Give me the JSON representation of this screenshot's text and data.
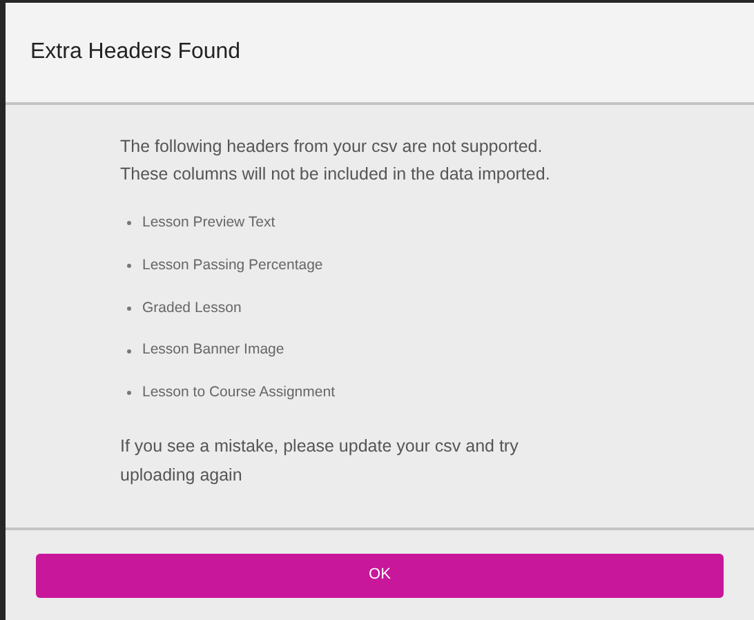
{
  "dialog": {
    "title": "Extra Headers Found",
    "intro": [
      "The following headers from your csv are not supported.",
      "These columns will not be included in the data imported."
    ],
    "headers": [
      "Lesson Preview Text",
      "Lesson Passing Percentage",
      "Graded Lesson",
      "Lesson Banner Image",
      "Lesson to Course Assignment"
    ],
    "note": "If you see a mistake, please update your csv and try uploading again",
    "button": "OK"
  }
}
